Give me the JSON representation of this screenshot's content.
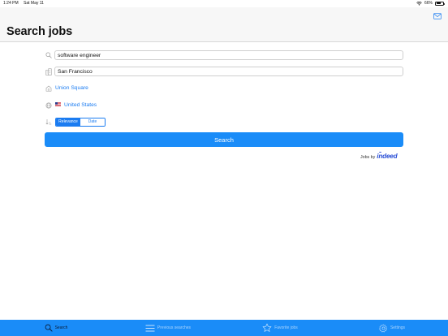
{
  "status_bar": {
    "time": "1:24 PM",
    "date": "Sat May 11",
    "battery": "66%",
    "battery_level": 0.66
  },
  "header": {
    "title": "Search jobs",
    "mail_icon": "envelope-icon"
  },
  "form": {
    "keywords_value": "software engineer",
    "location_value": "San Francisco",
    "radius_value": "Union Square",
    "country_value": "United States",
    "sort": {
      "options": [
        "Relevance",
        "Date"
      ],
      "selected": "Relevance"
    }
  },
  "search_button_label": "Search",
  "attribution": {
    "prefix": "Jobs by",
    "brand": "indeed"
  },
  "tabs": [
    {
      "label": "Search",
      "icon": "magnifier-icon",
      "active": true
    },
    {
      "label": "Previous searches",
      "icon": "list-icon",
      "active": false
    },
    {
      "label": "Favorite jobs",
      "icon": "star-icon",
      "active": false
    },
    {
      "label": "Settings",
      "icon": "gear-icon",
      "active": false
    }
  ],
  "colors": {
    "accent": "#1a8cf8",
    "link": "#1b7cf1",
    "indeed_brand": "#2a4fd6",
    "header_bg": "#f7f7f7"
  }
}
